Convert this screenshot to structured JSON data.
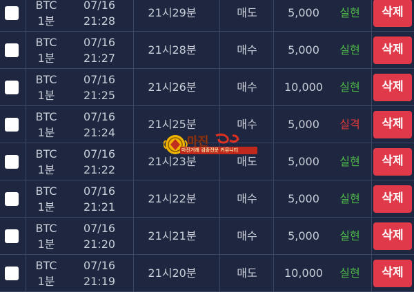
{
  "colors": {
    "background": "#1f2740",
    "grid_line": "#3c4766",
    "text": "#c9ced9",
    "win": "#4db848",
    "lose": "#e03a3a",
    "delete_button": "#e03a4a"
  },
  "rows": [
    {
      "asset": "BTC",
      "interval": "1분",
      "date": "07/16",
      "time": "21:28",
      "round": "21시29분",
      "type": "매도",
      "amount": "5,000",
      "result": "실현",
      "delete_label": "삭제"
    },
    {
      "asset": "BTC",
      "interval": "1분",
      "date": "07/16",
      "time": "21:27",
      "round": "21시28분",
      "type": "매수",
      "amount": "5,000",
      "result": "실현",
      "delete_label": "삭제"
    },
    {
      "asset": "BTC",
      "interval": "1분",
      "date": "07/16",
      "time": "21:25",
      "round": "21시26분",
      "type": "매수",
      "amount": "10,000",
      "result": "실현",
      "delete_label": "삭제"
    },
    {
      "asset": "BTC",
      "interval": "1분",
      "date": "07/16",
      "time": "21:24",
      "round": "21시25분",
      "type": "매수",
      "amount": "5,000",
      "result": "실격",
      "delete_label": "삭제"
    },
    {
      "asset": "BTC",
      "interval": "1분",
      "date": "07/16",
      "time": "21:22",
      "round": "21시23분",
      "type": "매도",
      "amount": "5,000",
      "result": "실현",
      "delete_label": "삭제"
    },
    {
      "asset": "BTC",
      "interval": "1분",
      "date": "07/16",
      "time": "21:21",
      "round": "21시22분",
      "type": "매수",
      "amount": "5,000",
      "result": "실현",
      "delete_label": "삭제"
    },
    {
      "asset": "BTC",
      "interval": "1분",
      "date": "07/16",
      "time": "21:20",
      "round": "21시21분",
      "type": "매수",
      "amount": "5,000",
      "result": "실현",
      "delete_label": "삭제"
    },
    {
      "asset": "BTC",
      "interval": "1분",
      "date": "07/16",
      "time": "21:19",
      "round": "21시20분",
      "type": "매도",
      "amount": "10,000",
      "result": "실현",
      "delete_label": "삭제"
    }
  ],
  "watermark": {
    "logo_text": "마진",
    "tagline": "마진거래 검증전문 커뮤니티"
  }
}
